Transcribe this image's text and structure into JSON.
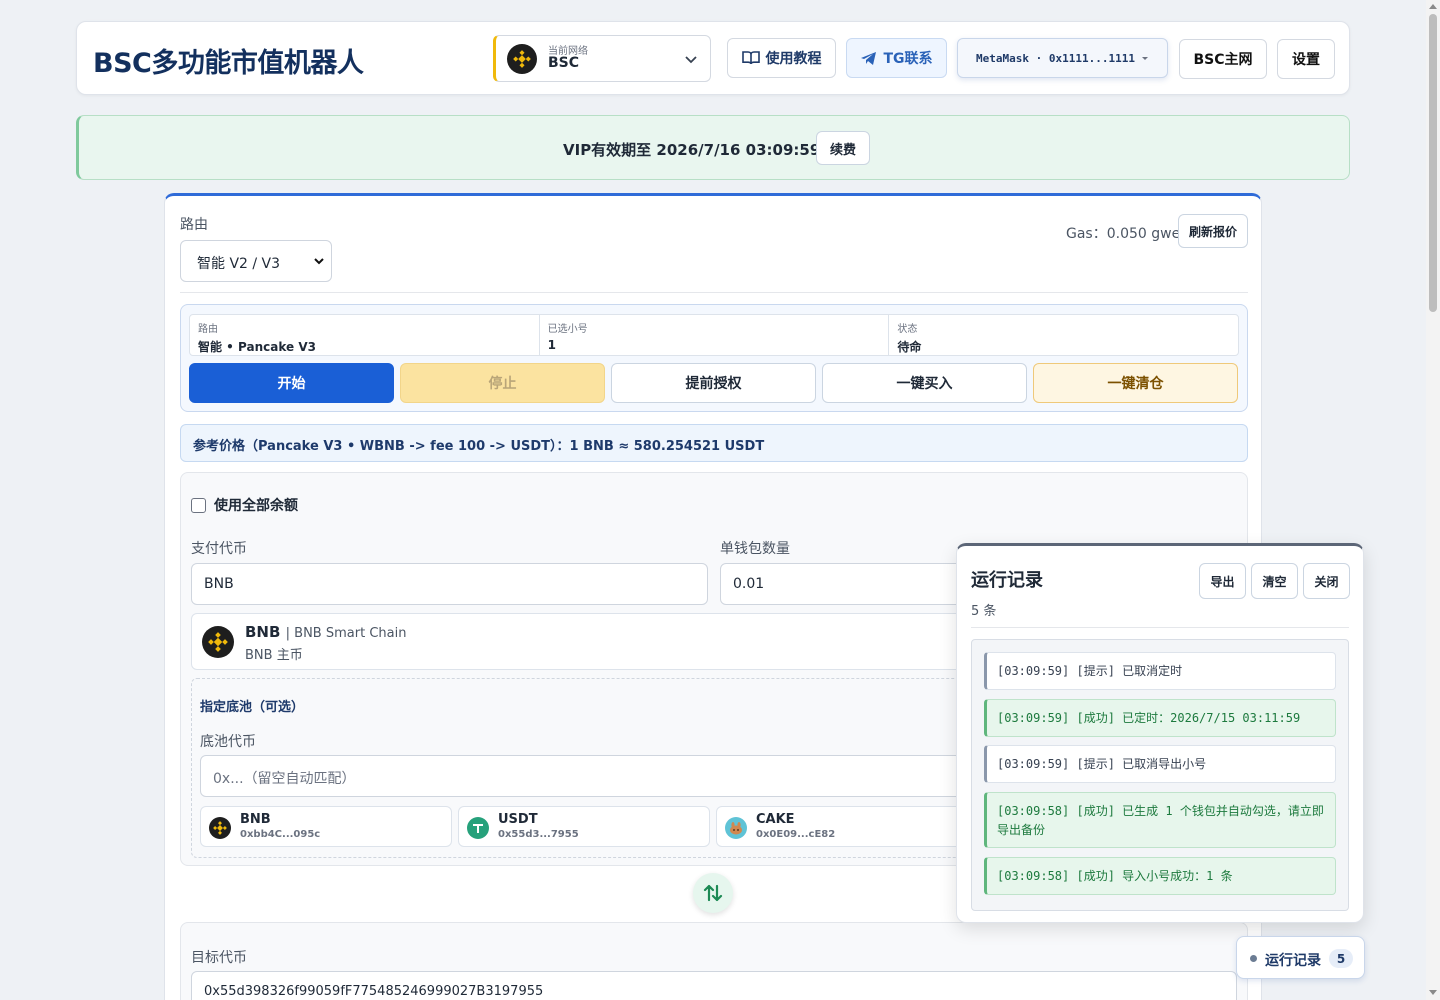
{
  "header": {
    "title": "BSC多功能市值机器人",
    "network": {
      "caption": "当前网络",
      "value": "BSC"
    },
    "tutorial_label": "使用教程",
    "tg_label": "TG联系",
    "wallet_label": "MetaMask · 0x1111...1111",
    "mainnet_label": "BSC主网",
    "settings_label": "设置"
  },
  "vip": {
    "text": "VIP有效期至 2026/7/16 03:09:59",
    "renew_label": "续费"
  },
  "route": {
    "label": "路由",
    "selected": "智能 V2 / V3",
    "gas_text": "Gas：0.050 gwei",
    "refresh_label": "刷新报价"
  },
  "status": {
    "route_cap": "路由",
    "route_val": "智能 • Pancake V3",
    "wallets_cap": "已选小号",
    "wallets_val": "1",
    "state_cap": "状态",
    "state_val": "待命"
  },
  "actions": {
    "start": "开始",
    "stop": "停止",
    "approve": "提前授权",
    "buy": "一键买入",
    "clear": "一键清仓"
  },
  "ref_price": "参考价格（Pancake V3 • WBNB -> fee 100 -> USDT）：1 BNB ≈ 580.254521 USDT",
  "trade": {
    "use_all_label": "使用全部余额",
    "pay_label": "支付代币",
    "pay_value": "BNB",
    "amount_label": "单钱包数量",
    "amount_value": "0.01",
    "token": {
      "name": "BNB",
      "chain": "| BNB Smart Chain",
      "sub": "BNB 主币"
    },
    "pool": {
      "title": "指定底池（可选）",
      "label": "底池代币",
      "placeholder": "0x...（留空自动匹配）",
      "chips": [
        {
          "name": "BNB",
          "addr": "0xbb4C...095c"
        },
        {
          "name": "USDT",
          "addr": "0x55d3...7955"
        },
        {
          "name": "CAKE",
          "addr": "0x0E09...cE82"
        }
      ]
    },
    "target_label": "目标代币",
    "target_value": "0x55d398326f99059fF775485246999027B3197955"
  },
  "log": {
    "title": "运行记录",
    "count": "5 条",
    "export_label": "导出",
    "clear_label": "清空",
    "close_label": "关闭",
    "entries": [
      {
        "text": "[03:09:59] [提示] 已取消定时"
      },
      {
        "text": "[03:09:59] [成功] 已定时：2026/7/15 03:11:59"
      },
      {
        "text": "[03:09:59] [提示] 已取消导出小号"
      },
      {
        "text": "[03:09:58] [成功] 已生成 1 个钱包并自动勾选，请立即导出备份"
      },
      {
        "text": "[03:09:58] [成功] 导入小号成功：1 条"
      }
    ]
  },
  "float_log": {
    "label": "运行记录",
    "count": "5"
  },
  "colors": {
    "primary": "#1a5fd6",
    "bnb": "#f0b90b",
    "usdt": "#26a17b",
    "cake": "#d1884f",
    "success": "#1d7a3e"
  }
}
